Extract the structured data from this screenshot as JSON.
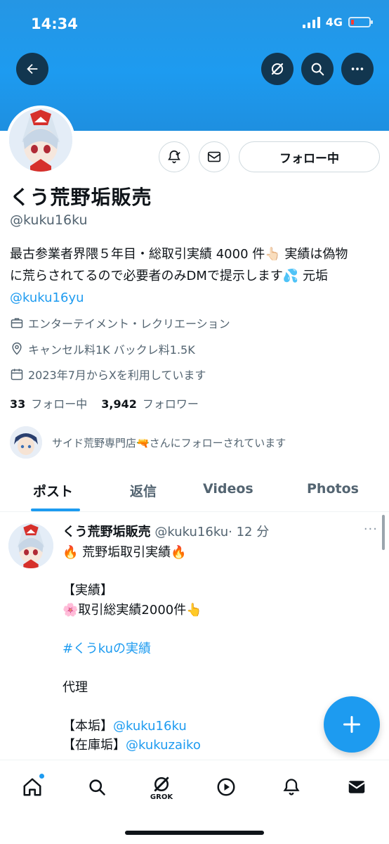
{
  "status_bar": {
    "time": "14:34",
    "network": "4G"
  },
  "header": {
    "back_icon": "arrow-left-icon",
    "grok_icon": "grok-icon",
    "search_icon": "search-icon",
    "more_icon": "more-icon"
  },
  "profile": {
    "display_name": "くう荒野垢販売",
    "handle": "@kuku16ku",
    "follow_button_label": "フォロー中",
    "bio_line1": "最古参業者界隈５年目・総取引実績 4000 件👆🏻 実績は偽物",
    "bio_line2": "に荒らされてるので必要者のみDMで提示します💦 元垢",
    "bio_link": "@kuku16yu",
    "category": "エンターテイメント・レクリエーション",
    "location": "キャンセル料1K バックレ料1.5K",
    "joined": "2023年7月からXを利用しています",
    "following_count": "33",
    "following_label": "フォロー中",
    "followers_count": "3,942",
    "followers_label": "フォロワー",
    "followed_by_text": "サイド荒野専門店🔫さんにフォローされています"
  },
  "tabs": [
    {
      "label": "ポスト"
    },
    {
      "label": "返信"
    },
    {
      "label": "Videos"
    },
    {
      "label": "Photos"
    }
  ],
  "tweet": {
    "name": "くう荒野垢販売",
    "handle": "@kuku16ku",
    "time": "· 12 分",
    "more": "···",
    "line1": "🔥 荒野垢取引実績🔥",
    "line2": "【実績】",
    "line3": "🌸取引総実績2000件👆",
    "hashtag": "#くうkuの実績",
    "line4": "代理",
    "line5_label": "【本垢】",
    "line5_link": "@kuku16ku",
    "line6_label": "【在庫垢】",
    "line6_link": "@kukuzaiko"
  },
  "bottom_nav": {
    "grok_label": "GROK"
  },
  "colors": {
    "accent": "#1d9bf0",
    "banner": "#1d9bf0",
    "text": "#0f1419",
    "secondary_text": "#536471"
  }
}
